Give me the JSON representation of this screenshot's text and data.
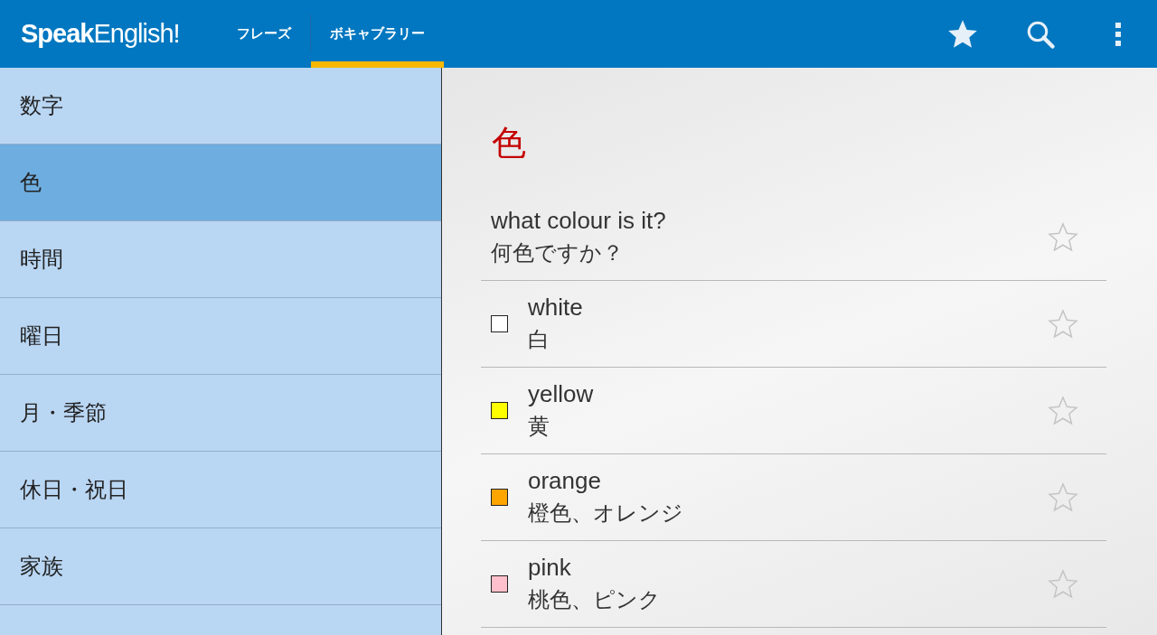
{
  "app_bar": {
    "logo": "**Speak**English!",
    "tabs": [
      {
        "label": "フレーズ",
        "selected": false
      },
      {
        "label": "ボキャブラリー",
        "selected": true
      }
    ],
    "actions": [
      {
        "kind": "favorites"
      },
      {
        "kind": "search"
      },
      {
        "kind": "overflow"
      }
    ]
  },
  "sidebar": {
    "items": [
      {
        "label": "数字",
        "selected": false
      },
      {
        "label": "色",
        "selected": true
      },
      {
        "label": "時間",
        "selected": false
      },
      {
        "label": "曜日",
        "selected": false
      },
      {
        "label": "月・季節",
        "selected": false
      },
      {
        "label": "休日・祝日",
        "selected": false
      },
      {
        "label": "家族",
        "selected": false
      }
    ]
  },
  "detail": {
    "title": "色",
    "entries": [
      {
        "kind": "phrase",
        "english": "what colour is it?",
        "japanese": "何色ですか？",
        "starred": false
      },
      {
        "kind": "color",
        "color": "#ffffff",
        "english": "white",
        "japanese": "白",
        "starred": false
      },
      {
        "kind": "color",
        "color": "#ffff00",
        "english": "yellow",
        "japanese": "黄",
        "starred": false
      },
      {
        "kind": "color",
        "color": "#ffa500",
        "english": "orange",
        "japanese": "橙色、オレンジ",
        "starred": false
      },
      {
        "kind": "color",
        "color": "#ffc0cb",
        "english": "pink",
        "japanese": "桃色、ピンク",
        "starred": false
      }
    ]
  }
}
